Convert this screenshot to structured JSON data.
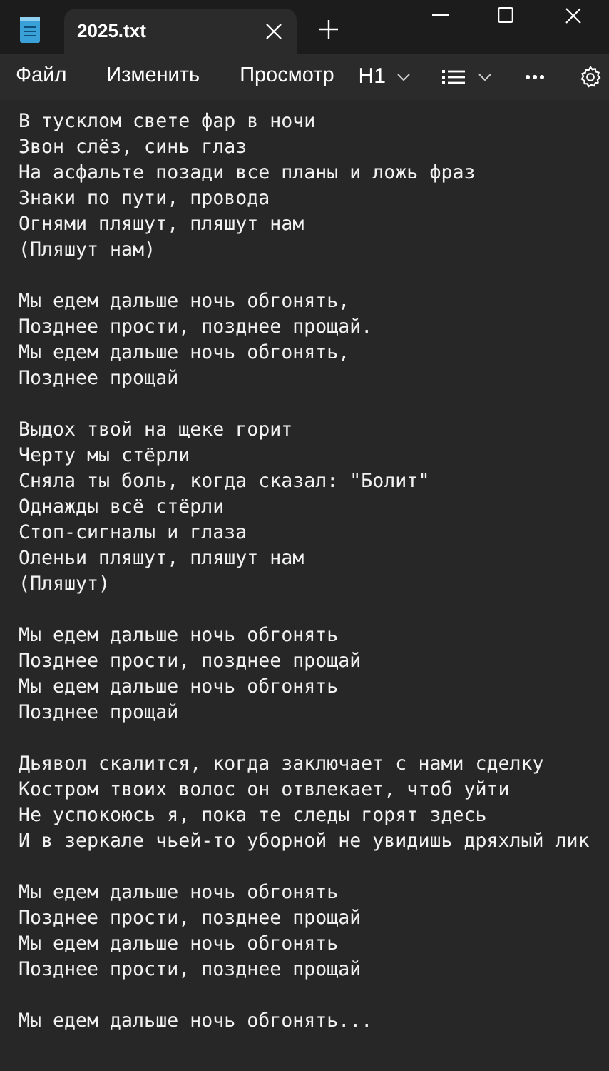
{
  "tab": {
    "title": "2025.txt",
    "selected": true
  },
  "menu": [
    "Файл",
    "Изменить",
    "Просмотр"
  ],
  "format": {
    "heading": "H1"
  },
  "stanzas": [
    [
      "В тусклом свете фар в ночи",
      "Звон слёз, синь глаз",
      "На асфальте позади все планы и ложь фраз",
      "Знаки по пути, провода",
      "Огнями пляшут, пляшут нам",
      "(Пляшут нам)"
    ],
    [
      "Мы едем дальше ночь обгонять,",
      "Позднее прости, позднее прощай.",
      "Мы едем дальше ночь обгонять,",
      "Позднее прощай"
    ],
    [
      "Выдох твой на щеке горит",
      "Черту мы стёрли",
      "Сняла ты боль, когда сказал: \"Болит\"",
      "Однажды всё стёрли",
      "Стоп-сигналы и глаза",
      "Оленьи пляшут, пляшут нам",
      "(Пляшут)"
    ],
    [
      "Мы едем дальше ночь обгонять",
      "Позднее прости, позднее прощай",
      "Мы едем дальше ночь обгонять",
      "Позднее прощай"
    ],
    [
      "Дьявол скалится, когда заключает с нами сделку",
      "Костром твоих волос он отвлекает, чтоб уйти",
      "Не успокоюсь я, пока те следы горят здесь",
      "И в зеркале чьей-то уборной не увидишь дряхлый лик"
    ],
    [
      "Мы едем дальше ночь обгонять",
      "Позднее прости, позднее прощай",
      "Мы едем дальше ночь обгонять",
      "Позднее прости, позднее прощай"
    ],
    [
      "Мы едем дальше ночь обгонять..."
    ]
  ]
}
